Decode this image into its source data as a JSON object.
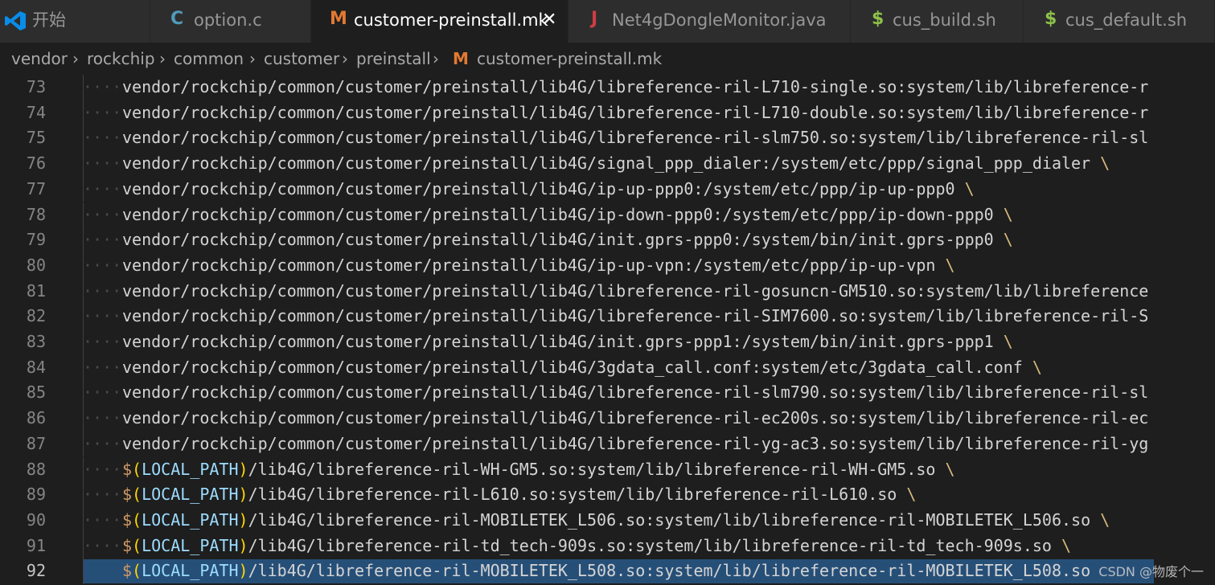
{
  "tabs": [
    {
      "label": "开始",
      "icon": "vscode-logo-icon",
      "active": false
    },
    {
      "label": "option.c",
      "icon": "C",
      "icon_color": "#519aba",
      "active": false
    },
    {
      "label": "customer-preinstall.mk",
      "icon": "M",
      "icon_color": "#e37933",
      "active": true,
      "close": "✕"
    },
    {
      "label": "Net4gDongleMonitor.java",
      "icon": "J",
      "icon_color": "#cc3e44",
      "active": false
    },
    {
      "label": "cus_build.sh",
      "icon": "$",
      "icon_color": "#8dc149",
      "active": false
    },
    {
      "label": "cus_default.sh",
      "icon": "$",
      "icon_color": "#8dc149",
      "active": false
    }
  ],
  "breadcrumb": {
    "items": [
      "vendor",
      "rockchip",
      "common",
      "customer",
      "preinstall"
    ],
    "file_icon": "M",
    "file": "customer-preinstall.mk",
    "separator": "›"
  },
  "editor": {
    "indent_dots": "····",
    "selected_line": "92",
    "lines": [
      {
        "num": "73",
        "kind": "plain",
        "text": "vendor/rockchip/common/customer/preinstall/lib4G/libreference-ril-L710-single.so:system/lib/libreference-r"
      },
      {
        "num": "74",
        "kind": "plain",
        "text": "vendor/rockchip/common/customer/preinstall/lib4G/libreference-ril-L710-double.so:system/lib/libreference-r"
      },
      {
        "num": "75",
        "kind": "plain",
        "text": "vendor/rockchip/common/customer/preinstall/lib4G/libreference-ril-slm750.so:system/lib/libreference-ril-sl"
      },
      {
        "num": "76",
        "kind": "plain",
        "text": "vendor/rockchip/common/customer/preinstall/lib4G/signal_ppp_dialer:/system/etc/ppp/signal_ppp_dialer ",
        "cont": "\\"
      },
      {
        "num": "77",
        "kind": "plain",
        "text": "vendor/rockchip/common/customer/preinstall/lib4G/ip-up-ppp0:/system/etc/ppp/ip-up-ppp0 ",
        "cont": "\\"
      },
      {
        "num": "78",
        "kind": "plain",
        "text": "vendor/rockchip/common/customer/preinstall/lib4G/ip-down-ppp0:/system/etc/ppp/ip-down-ppp0 ",
        "cont": "\\"
      },
      {
        "num": "79",
        "kind": "plain",
        "text": "vendor/rockchip/common/customer/preinstall/lib4G/init.gprs-ppp0:/system/bin/init.gprs-ppp0 ",
        "cont": "\\"
      },
      {
        "num": "80",
        "kind": "plain",
        "text": "vendor/rockchip/common/customer/preinstall/lib4G/ip-up-vpn:/system/etc/ppp/ip-up-vpn ",
        "cont": "\\"
      },
      {
        "num": "81",
        "kind": "plain",
        "text": "vendor/rockchip/common/customer/preinstall/lib4G/libreference-ril-gosuncn-GM510.so:system/lib/libreference"
      },
      {
        "num": "82",
        "kind": "plain",
        "text": "vendor/rockchip/common/customer/preinstall/lib4G/libreference-ril-SIM7600.so:system/lib/libreference-ril-S"
      },
      {
        "num": "83",
        "kind": "plain",
        "text": "vendor/rockchip/common/customer/preinstall/lib4G/init.gprs-ppp1:/system/bin/init.gprs-ppp1 ",
        "cont": "\\"
      },
      {
        "num": "84",
        "kind": "plain",
        "text": "vendor/rockchip/common/customer/preinstall/lib4G/3gdata_call.conf:system/etc/3gdata_call.conf ",
        "cont": "\\"
      },
      {
        "num": "85",
        "kind": "plain",
        "text": "vendor/rockchip/common/customer/preinstall/lib4G/libreference-ril-slm790.so:system/lib/libreference-ril-sl"
      },
      {
        "num": "86",
        "kind": "plain",
        "text": "vendor/rockchip/common/customer/preinstall/lib4G/libreference-ril-ec200s.so:system/lib/libreference-ril-ec"
      },
      {
        "num": "87",
        "kind": "plain",
        "text": "vendor/rockchip/common/customer/preinstall/lib4G/libreference-ril-yg-ac3.so:system/lib/libreference-ril-yg"
      },
      {
        "num": "88",
        "kind": "local",
        "dollar": "$",
        "open": "(",
        "var": "LOCAL_PATH",
        "close": ")",
        "text": "/lib4G/libreference-ril-WH-GM5.so:system/lib/libreference-ril-WH-GM5.so ",
        "cont": "\\"
      },
      {
        "num": "89",
        "kind": "local",
        "dollar": "$",
        "open": "(",
        "var": "LOCAL_PATH",
        "close": ")",
        "text": "/lib4G/libreference-ril-L610.so:system/lib/libreference-ril-L610.so ",
        "cont": "\\"
      },
      {
        "num": "90",
        "kind": "local",
        "dollar": "$",
        "open": "(",
        "var": "LOCAL_PATH",
        "close": ")",
        "text": "/lib4G/libreference-ril-MOBILETEK_L506.so:system/lib/libreference-ril-MOBILETEK_L506.so ",
        "cont": "\\"
      },
      {
        "num": "91",
        "kind": "local",
        "dollar": "$",
        "open": "(",
        "var": "LOCAL_PATH",
        "close": ")",
        "text": "/lib4G/libreference-ril-td_tech-909s.so:system/lib/libreference-ril-td_tech-909s.so ",
        "cont": "\\"
      },
      {
        "num": "92",
        "kind": "local",
        "dollar": "$",
        "open": "(",
        "var": "LOCAL_PATH",
        "close": ")",
        "text": "/lib4G/libreference-ril-MOBILETEK_L508.so:system/lib/libreference-ril-MOBILETEK_L508.so"
      }
    ]
  },
  "watermark": "CSDN @物废个一",
  "colors": {
    "background": "#1e1e1e",
    "tab_inactive": "#2d2d2d",
    "selection": "#264f78",
    "text": "#d4d4d4",
    "variable": "#9cdcfe",
    "paren": "#ffd700",
    "dollar": "#d19a66"
  }
}
